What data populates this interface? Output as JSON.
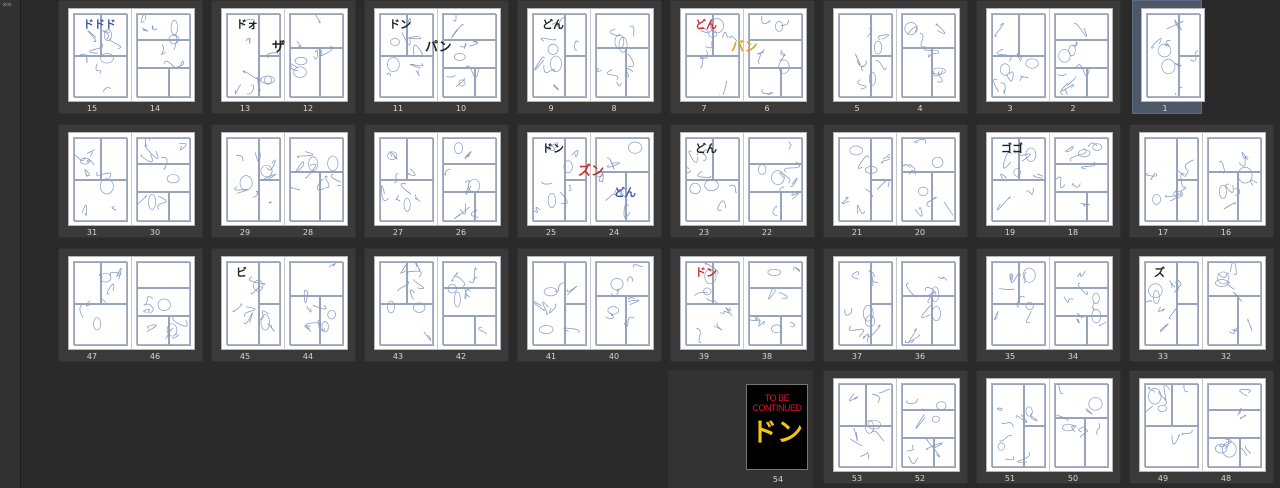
{
  "rail": {
    "expand_glyph": "»»"
  },
  "rows": [
    [
      {
        "left": "15",
        "right": "14",
        "sfx": [
          {
            "t": "ドドド",
            "c": "#3a55a8"
          }
        ]
      },
      {
        "left": "13",
        "right": "12",
        "sfx": [
          {
            "t": "ドォ",
            "c": "#222"
          },
          {
            "t": "ザ",
            "c": "#222"
          }
        ]
      },
      {
        "left": "11",
        "right": "10",
        "sfx": [
          {
            "t": "ドン",
            "c": "#222"
          },
          {
            "t": "パン",
            "c": "#222"
          }
        ]
      },
      {
        "left": "9",
        "right": "8",
        "sfx": [
          {
            "t": "どん",
            "c": "#222"
          }
        ]
      },
      {
        "left": "7",
        "right": "6",
        "sfx": [
          {
            "t": "どん",
            "c": "#d22a2a"
          },
          {
            "t": "バン",
            "c": "#e0a21a"
          }
        ]
      },
      {
        "left": "5",
        "right": "4",
        "sfx": []
      },
      {
        "left": "3",
        "right": "2",
        "sfx": []
      }
    ],
    [
      {
        "left": "31",
        "right": "30",
        "sfx": []
      },
      {
        "left": "29",
        "right": "28",
        "sfx": []
      },
      {
        "left": "27",
        "right": "26",
        "sfx": []
      },
      {
        "left": "25",
        "right": "24",
        "sfx": [
          {
            "t": "ドン",
            "c": "#222"
          },
          {
            "t": "ズン",
            "c": "#d22a2a"
          },
          {
            "t": "どん",
            "c": "#3a55a8"
          }
        ]
      },
      {
        "left": "23",
        "right": "22",
        "sfx": [
          {
            "t": "どん",
            "c": "#222"
          }
        ]
      },
      {
        "left": "21",
        "right": "20",
        "sfx": []
      },
      {
        "left": "19",
        "right": "18",
        "sfx": [
          {
            "t": "ゴゴ",
            "c": "#222"
          }
        ]
      },
      {
        "left": "17",
        "right": "16",
        "sfx": []
      }
    ],
    [
      {
        "left": "47",
        "right": "46",
        "sfx": []
      },
      {
        "left": "45",
        "right": "44",
        "sfx": [
          {
            "t": "ビ",
            "c": "#222"
          }
        ]
      },
      {
        "left": "43",
        "right": "42",
        "sfx": []
      },
      {
        "left": "41",
        "right": "40",
        "sfx": []
      },
      {
        "left": "39",
        "right": "38",
        "sfx": [
          {
            "t": "ドン",
            "c": "#d22a2a"
          }
        ]
      },
      {
        "left": "37",
        "right": "36",
        "sfx": []
      },
      {
        "left": "35",
        "right": "34",
        "sfx": []
      },
      {
        "left": "33",
        "right": "32",
        "sfx": [
          {
            "t": "ズ",
            "c": "#222"
          }
        ]
      }
    ],
    [
      {
        "left": "53",
        "right": "52",
        "sfx": []
      },
      {
        "left": "51",
        "right": "50",
        "sfx": []
      },
      {
        "left": "49",
        "right": "48",
        "sfx": []
      }
    ]
  ],
  "single_page": {
    "num": "1"
  },
  "cover": {
    "lines": [
      "TO BE",
      "CONTINUED"
    ],
    "sfx": "ドン",
    "num": "54"
  },
  "colors": {
    "background": "#2a2a2a",
    "tile": "#3a3a3a",
    "selected": "#4d5868",
    "sketch": "#8a9cc4"
  }
}
